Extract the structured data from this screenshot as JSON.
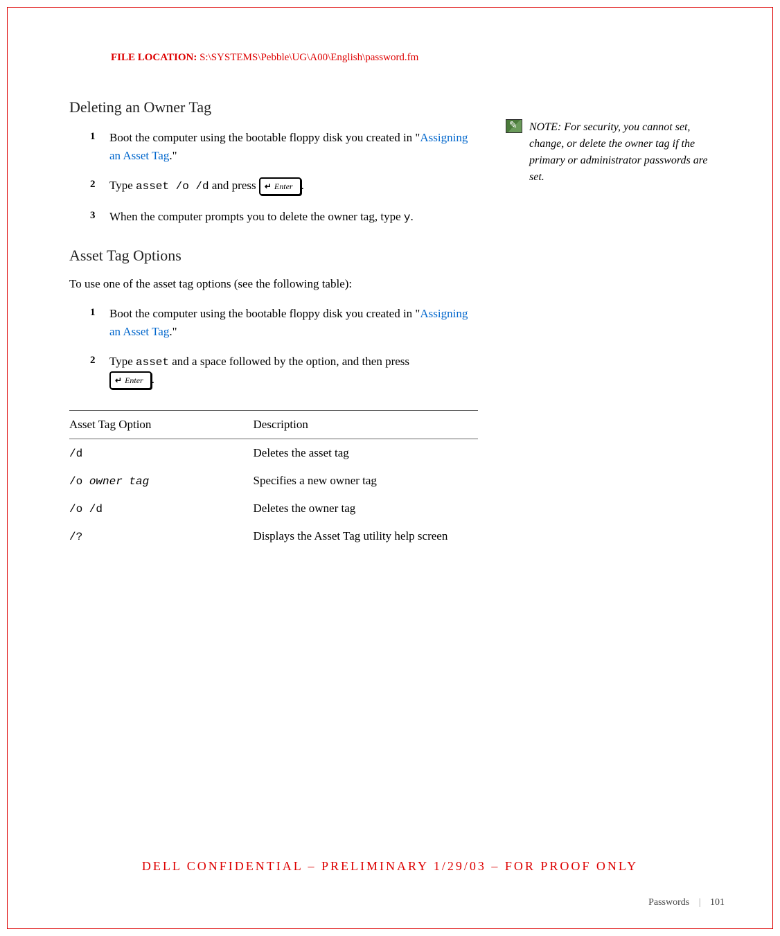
{
  "fileLocation": {
    "label": "FILE LOCATION:",
    "path": "S:\\SYSTEMS\\Pebble\\UG\\A00\\English\\password.fm"
  },
  "section1": {
    "heading": "Deleting an Owner Tag",
    "steps": [
      {
        "num": "1",
        "text1": "Boot the computer using the bootable floppy disk you created in \"",
        "link": "Assigning an Asset Tag",
        "text2": ".\""
      },
      {
        "num": "2",
        "text1": "Type ",
        "code": "asset /o /d",
        "text2": " and press ",
        "keyLabel": "Enter",
        "text3": "."
      },
      {
        "num": "3",
        "text1": "When the computer prompts you to delete the owner tag, type ",
        "code": "y",
        "text2": "."
      }
    ]
  },
  "section2": {
    "heading": "Asset Tag Options",
    "intro": "To use one of the asset tag options (see the following table):",
    "steps": [
      {
        "num": "1",
        "text1": "Boot the computer using the bootable floppy disk you created in \"",
        "link": "Assigning an Asset Tag",
        "text2": ".\""
      },
      {
        "num": "2",
        "text1": "Type ",
        "code": "asset",
        "text2": " and a space followed by the option, and then press ",
        "keyLabel": "Enter",
        "text3": "."
      }
    ]
  },
  "table": {
    "headers": {
      "col1": "Asset Tag Option",
      "col2": "Description"
    },
    "rows": [
      {
        "option": "/d",
        "desc": "Deletes the asset tag"
      },
      {
        "optionPrefix": "/o ",
        "optionItalic": "owner tag",
        "desc": "Specifies a new owner tag"
      },
      {
        "option": "/o /d",
        "desc": "Deletes the owner tag"
      },
      {
        "option": "/?",
        "desc": "Displays the Asset Tag utility help screen"
      }
    ]
  },
  "note": {
    "label": "NOTE: ",
    "text": "For security, you cannot set, change, or delete the owner tag if the primary or administrator passwords are set."
  },
  "confidential": "DELL CONFIDENTIAL – PRELIMINARY 1/29/03 – FOR PROOF ONLY",
  "footer": {
    "section": "Passwords",
    "page": "101"
  }
}
